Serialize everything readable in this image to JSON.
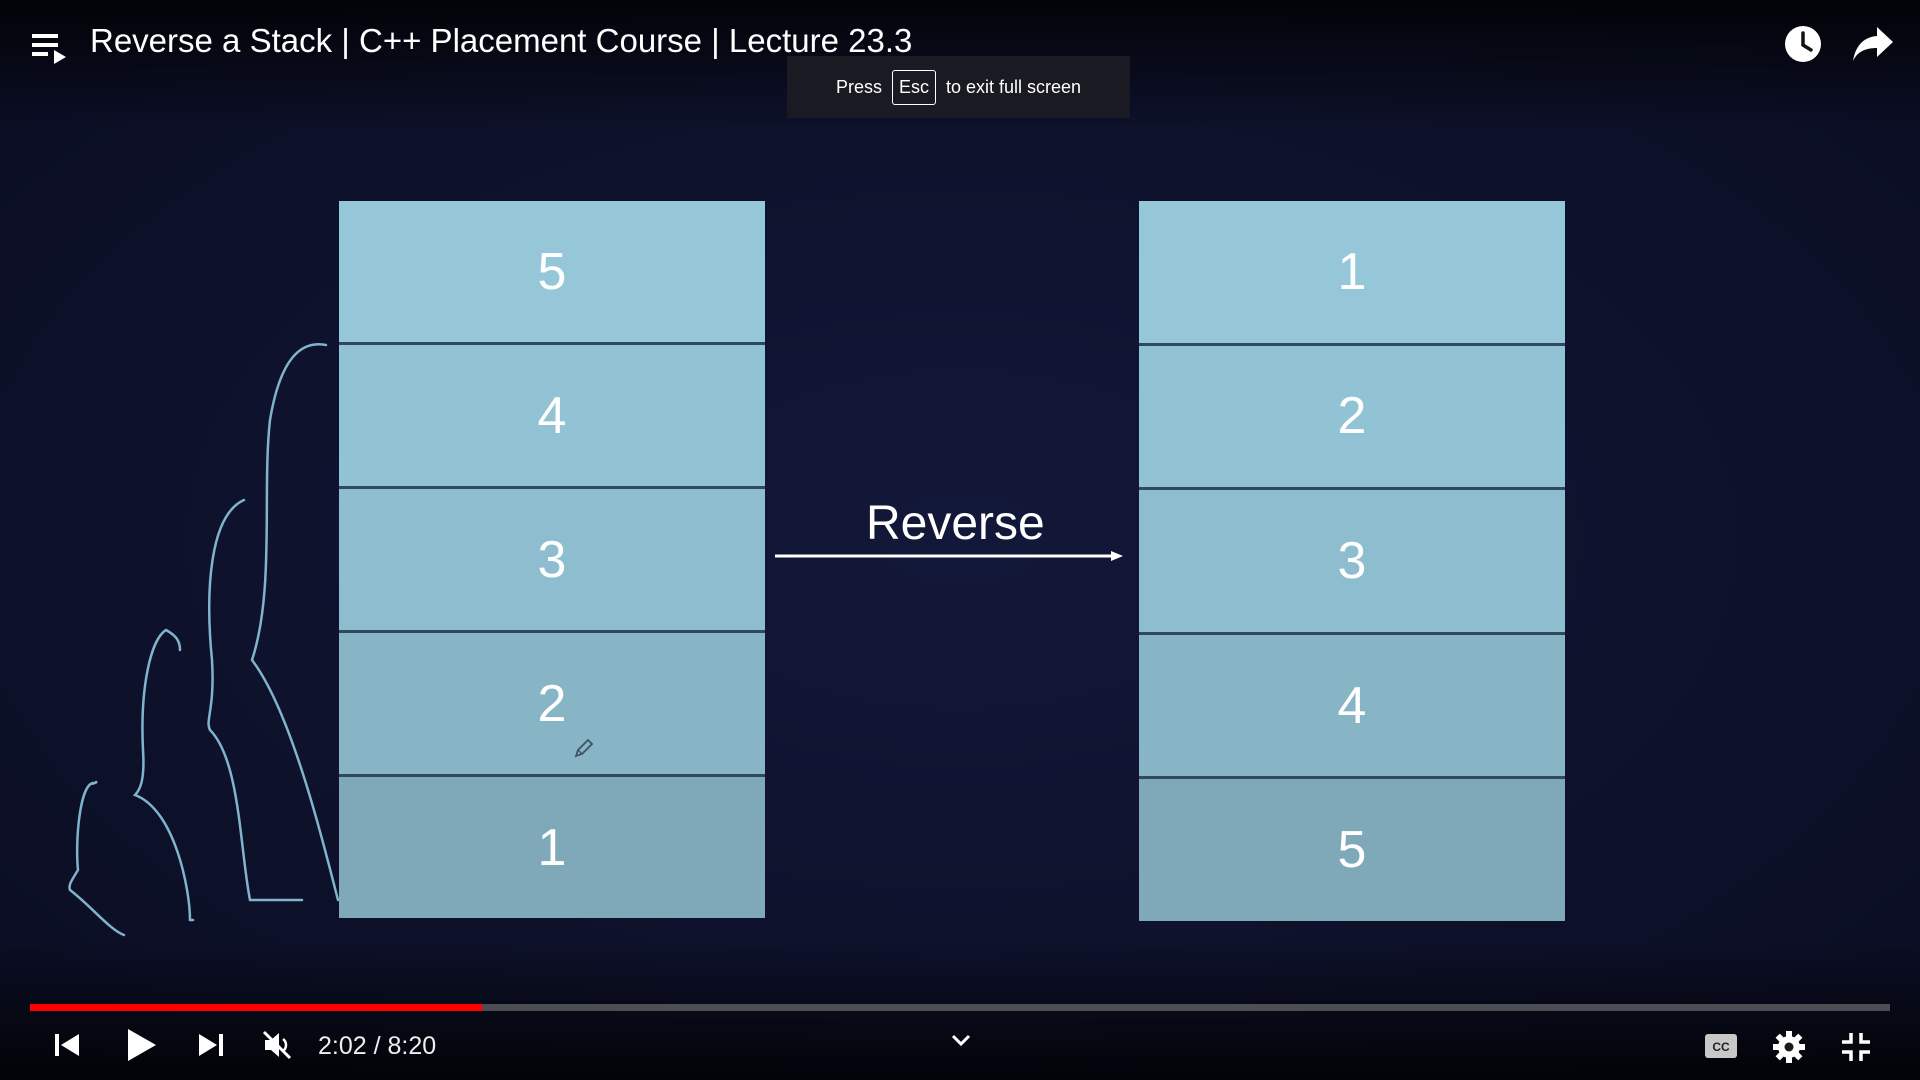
{
  "header": {
    "title": "Reverse a Stack | C++ Placement Course | Lecture 23.3"
  },
  "fullscreen_hint": {
    "before": "Press",
    "key": "Esc",
    "after": "to exit full screen"
  },
  "slide": {
    "left_stack": [
      "5",
      "4",
      "3",
      "2",
      "1"
    ],
    "right_stack": [
      "1",
      "2",
      "3",
      "4",
      "5"
    ],
    "arrow_label": "Reverse"
  },
  "player": {
    "time_display": "2:02 / 8:20",
    "progress_fraction": 0.243,
    "progress_color": "#ff0000",
    "icons": [
      "playlist-icon",
      "watch-later-icon",
      "share-icon",
      "previous-icon",
      "play-icon",
      "next-icon",
      "muted-volume-icon",
      "chevron-down-icon",
      "captions-icon",
      "settings-icon",
      "exit-fullscreen-icon"
    ]
  }
}
